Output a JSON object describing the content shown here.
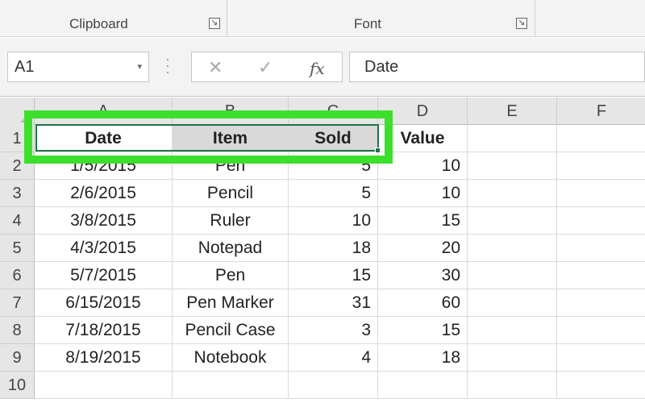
{
  "ribbon": {
    "groups": [
      {
        "label": "Clipboard"
      },
      {
        "label": "Font"
      }
    ],
    "launcher_glyph": "↘"
  },
  "formula_bar": {
    "name_box": "A1",
    "name_box_caret": "▾",
    "cancel_glyph": "✕",
    "enter_glyph": "✓",
    "fx_glyph": "fx",
    "content": "Date"
  },
  "columns": [
    "A",
    "B",
    "C",
    "D",
    "E",
    "F"
  ],
  "rows": [
    "1",
    "2",
    "3",
    "4",
    "5",
    "6",
    "7",
    "8",
    "9",
    "10"
  ],
  "cells": [
    [
      "Date",
      "Item",
      "Sold",
      "Value"
    ],
    [
      "1/5/2015",
      "Pen",
      "5",
      "10"
    ],
    [
      "2/6/2015",
      "Pencil",
      "5",
      "10"
    ],
    [
      "3/8/2015",
      "Ruler",
      "10",
      "15"
    ],
    [
      "4/3/2015",
      "Notepad",
      "18",
      "20"
    ],
    [
      "5/7/2015",
      "Pen",
      "15",
      "30"
    ],
    [
      "6/15/2015",
      "Pen Marker",
      "31",
      "60"
    ],
    [
      "7/18/2015",
      "Pencil Case",
      "3",
      "15"
    ],
    [
      "8/19/2015",
      "Notebook",
      "4",
      "18"
    ],
    [
      "",
      "",
      "",
      ""
    ]
  ],
  "colors": {
    "highlight": "#3ddf2d",
    "selection": "#217346"
  }
}
